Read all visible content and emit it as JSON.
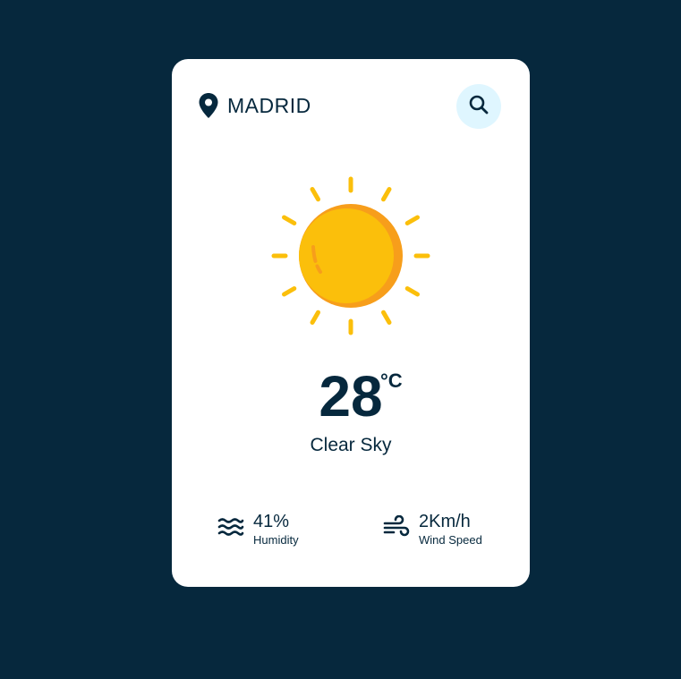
{
  "header": {
    "city": "MADRID",
    "location_icon": "map-pin-icon",
    "search_icon": "search-icon"
  },
  "weather": {
    "icon": "sun-icon",
    "temperature": "28",
    "unit": "°C",
    "description": "Clear Sky"
  },
  "details": {
    "humidity": {
      "value": "41%",
      "label": "Humidity",
      "icon": "water-waves-icon"
    },
    "wind": {
      "value": "2Km/h",
      "label": "Wind Speed",
      "icon": "wind-icon"
    }
  },
  "colors": {
    "background": "#06283d",
    "card": "#ffffff",
    "text": "#06283d",
    "search_button_bg": "#dff6ff",
    "sun": "#fbbf0b",
    "sun_shade": "#f79e1b"
  }
}
